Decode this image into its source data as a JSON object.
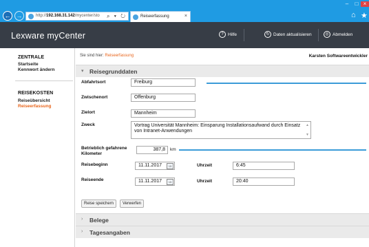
{
  "browser": {
    "url_prefix": "http://",
    "url_host": "192.168.31.142",
    "url_path": "/mycenter/sto",
    "address_icons": "⌕ ▾ ↻",
    "tab_title": "Reiseerfassung",
    "tab_close": "×"
  },
  "header": {
    "app_title": "Lexware myCenter",
    "help_label": "Hilfe",
    "refresh_label": "Daten aktualisieren",
    "logout_label": "Abmelden"
  },
  "sidebar": {
    "section1_title": "ZENTRALE",
    "section1_items": [
      "Startseite",
      "Kennwort ändern"
    ],
    "section2_title": "REISEKOSTEN",
    "section2_items": [
      "Reiseübersicht",
      "Reiseerfassung"
    ]
  },
  "breadcrumb": {
    "prefix": "Sie sind hier:",
    "current": "Reiseerfassung"
  },
  "user_name": "Karsten Softwareentwickler",
  "reisegrunddaten": {
    "title": "Reisegrunddaten",
    "abfahrtsort_label": "Abfahrtsort",
    "abfahrtsort_value": "Freiburg",
    "zwischenort_label": "Zwischenort",
    "zwischenort_value": "Offenburg",
    "zielort_label": "Zielort",
    "zielort_value": "Mannheim",
    "zweck_label": "Zweck",
    "zweck_value": "Vortrag Universität Mannheim: Einsparung Installationsaufwand durch Einsatz von Intranet-Anwendungen",
    "km_label": "Betrieblich gefahrene Kilometer",
    "km_value": "387,8",
    "km_unit": "km",
    "reisebeginn_label": "Reisebeginn",
    "reisebeginn_date": "11.11.2017",
    "reisebeginn_time_label": "Uhrzeit",
    "reisebeginn_time": "6:45",
    "reiseende_label": "Reiseende",
    "reiseende_date": "11.11.2017",
    "reiseende_time_label": "Uhrzeit",
    "reiseende_time": "20:40"
  },
  "buttons": {
    "save": "Reise speichern",
    "discard": "Verwerfen"
  },
  "collapsed_sections": {
    "belege": "Belege",
    "tagesangaben": "Tagesangaben"
  },
  "colors": {
    "chrome_blue": "#1f9be3",
    "header_dark": "#373d46",
    "accent_orange": "#e8641a",
    "field_line_blue": "#3a9bd8"
  },
  "icons": {
    "back": "←",
    "forward": "→",
    "home": "⌂",
    "star": "★",
    "help": "?",
    "refresh": "↻",
    "logout": "◎",
    "chevron_down": "▾",
    "chevron_right": "›",
    "calendar": "15"
  }
}
